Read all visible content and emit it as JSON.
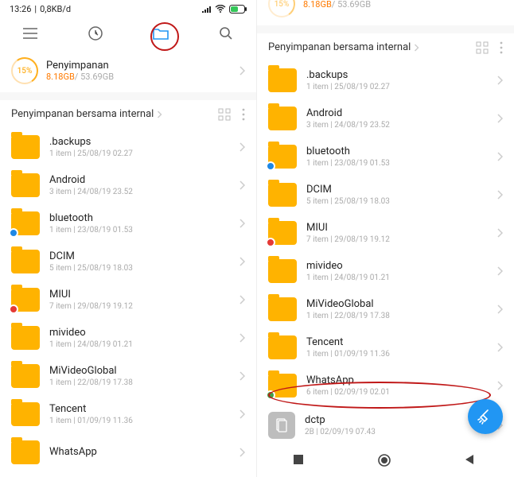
{
  "statusbar": {
    "time": "13:26",
    "net": "0,8KB/d"
  },
  "storage": {
    "percent": "15%",
    "title": "Penyimpanan",
    "used": "8.18GB",
    "sep": "/ ",
    "total": "53.69GB"
  },
  "section": {
    "title": "Penyimpanan bersama internal"
  },
  "left_folders": [
    {
      "name": ".backups",
      "meta": "1 item  |  25/08/19 02.27",
      "badge": null
    },
    {
      "name": "Android",
      "meta": "3 item  |  24/08/19 23.52",
      "badge": null
    },
    {
      "name": "bluetooth",
      "meta": "1 item  |  23/08/19 01.53",
      "badge": "blue"
    },
    {
      "name": "DCIM",
      "meta": "5 item  |  25/08/19 18.03",
      "badge": null
    },
    {
      "name": "MIUI",
      "meta": "7 item  |  29/08/19 19.12",
      "badge": "red"
    },
    {
      "name": "mivideo",
      "meta": "1 item  |  24/08/19 01.21",
      "badge": null
    },
    {
      "name": "MiVideoGlobal",
      "meta": "1 item  |  22/08/19 17.38",
      "badge": null
    },
    {
      "name": "Tencent",
      "meta": "1 item  |  01/09/19 11.36",
      "badge": null
    },
    {
      "name": "WhatsApp",
      "meta": "",
      "badge": null
    }
  ],
  "right_storage": {
    "percent": "15%",
    "used": "8.18GB",
    "sep": "/ ",
    "total": "53.69GB"
  },
  "right_folders": [
    {
      "name": ".backups",
      "meta": "1 item  |  25/08/19 02.27",
      "badge": null
    },
    {
      "name": "Android",
      "meta": "3 item  |  24/08/19 23.52",
      "badge": null
    },
    {
      "name": "bluetooth",
      "meta": "1 item  |  23/08/19 01.53",
      "badge": "blue"
    },
    {
      "name": "DCIM",
      "meta": "5 item  |  25/08/19 18.03",
      "badge": null
    },
    {
      "name": "MIUI",
      "meta": "7 item  |  29/08/19 19.12",
      "badge": "red"
    },
    {
      "name": "mivideo",
      "meta": "1 item  |  24/08/19 01.21",
      "badge": null
    },
    {
      "name": "MiVideoGlobal",
      "meta": "1 item  |  22/08/19 17.38",
      "badge": null
    },
    {
      "name": "Tencent",
      "meta": "1 item  |  01/09/19 11.36",
      "badge": null
    },
    {
      "name": "WhatsApp",
      "meta": "6 item  |  02/09/19 02.01",
      "badge": "green"
    }
  ],
  "right_file": {
    "name": "dctp",
    "meta": "2B  |  02/09/19 07.43"
  }
}
